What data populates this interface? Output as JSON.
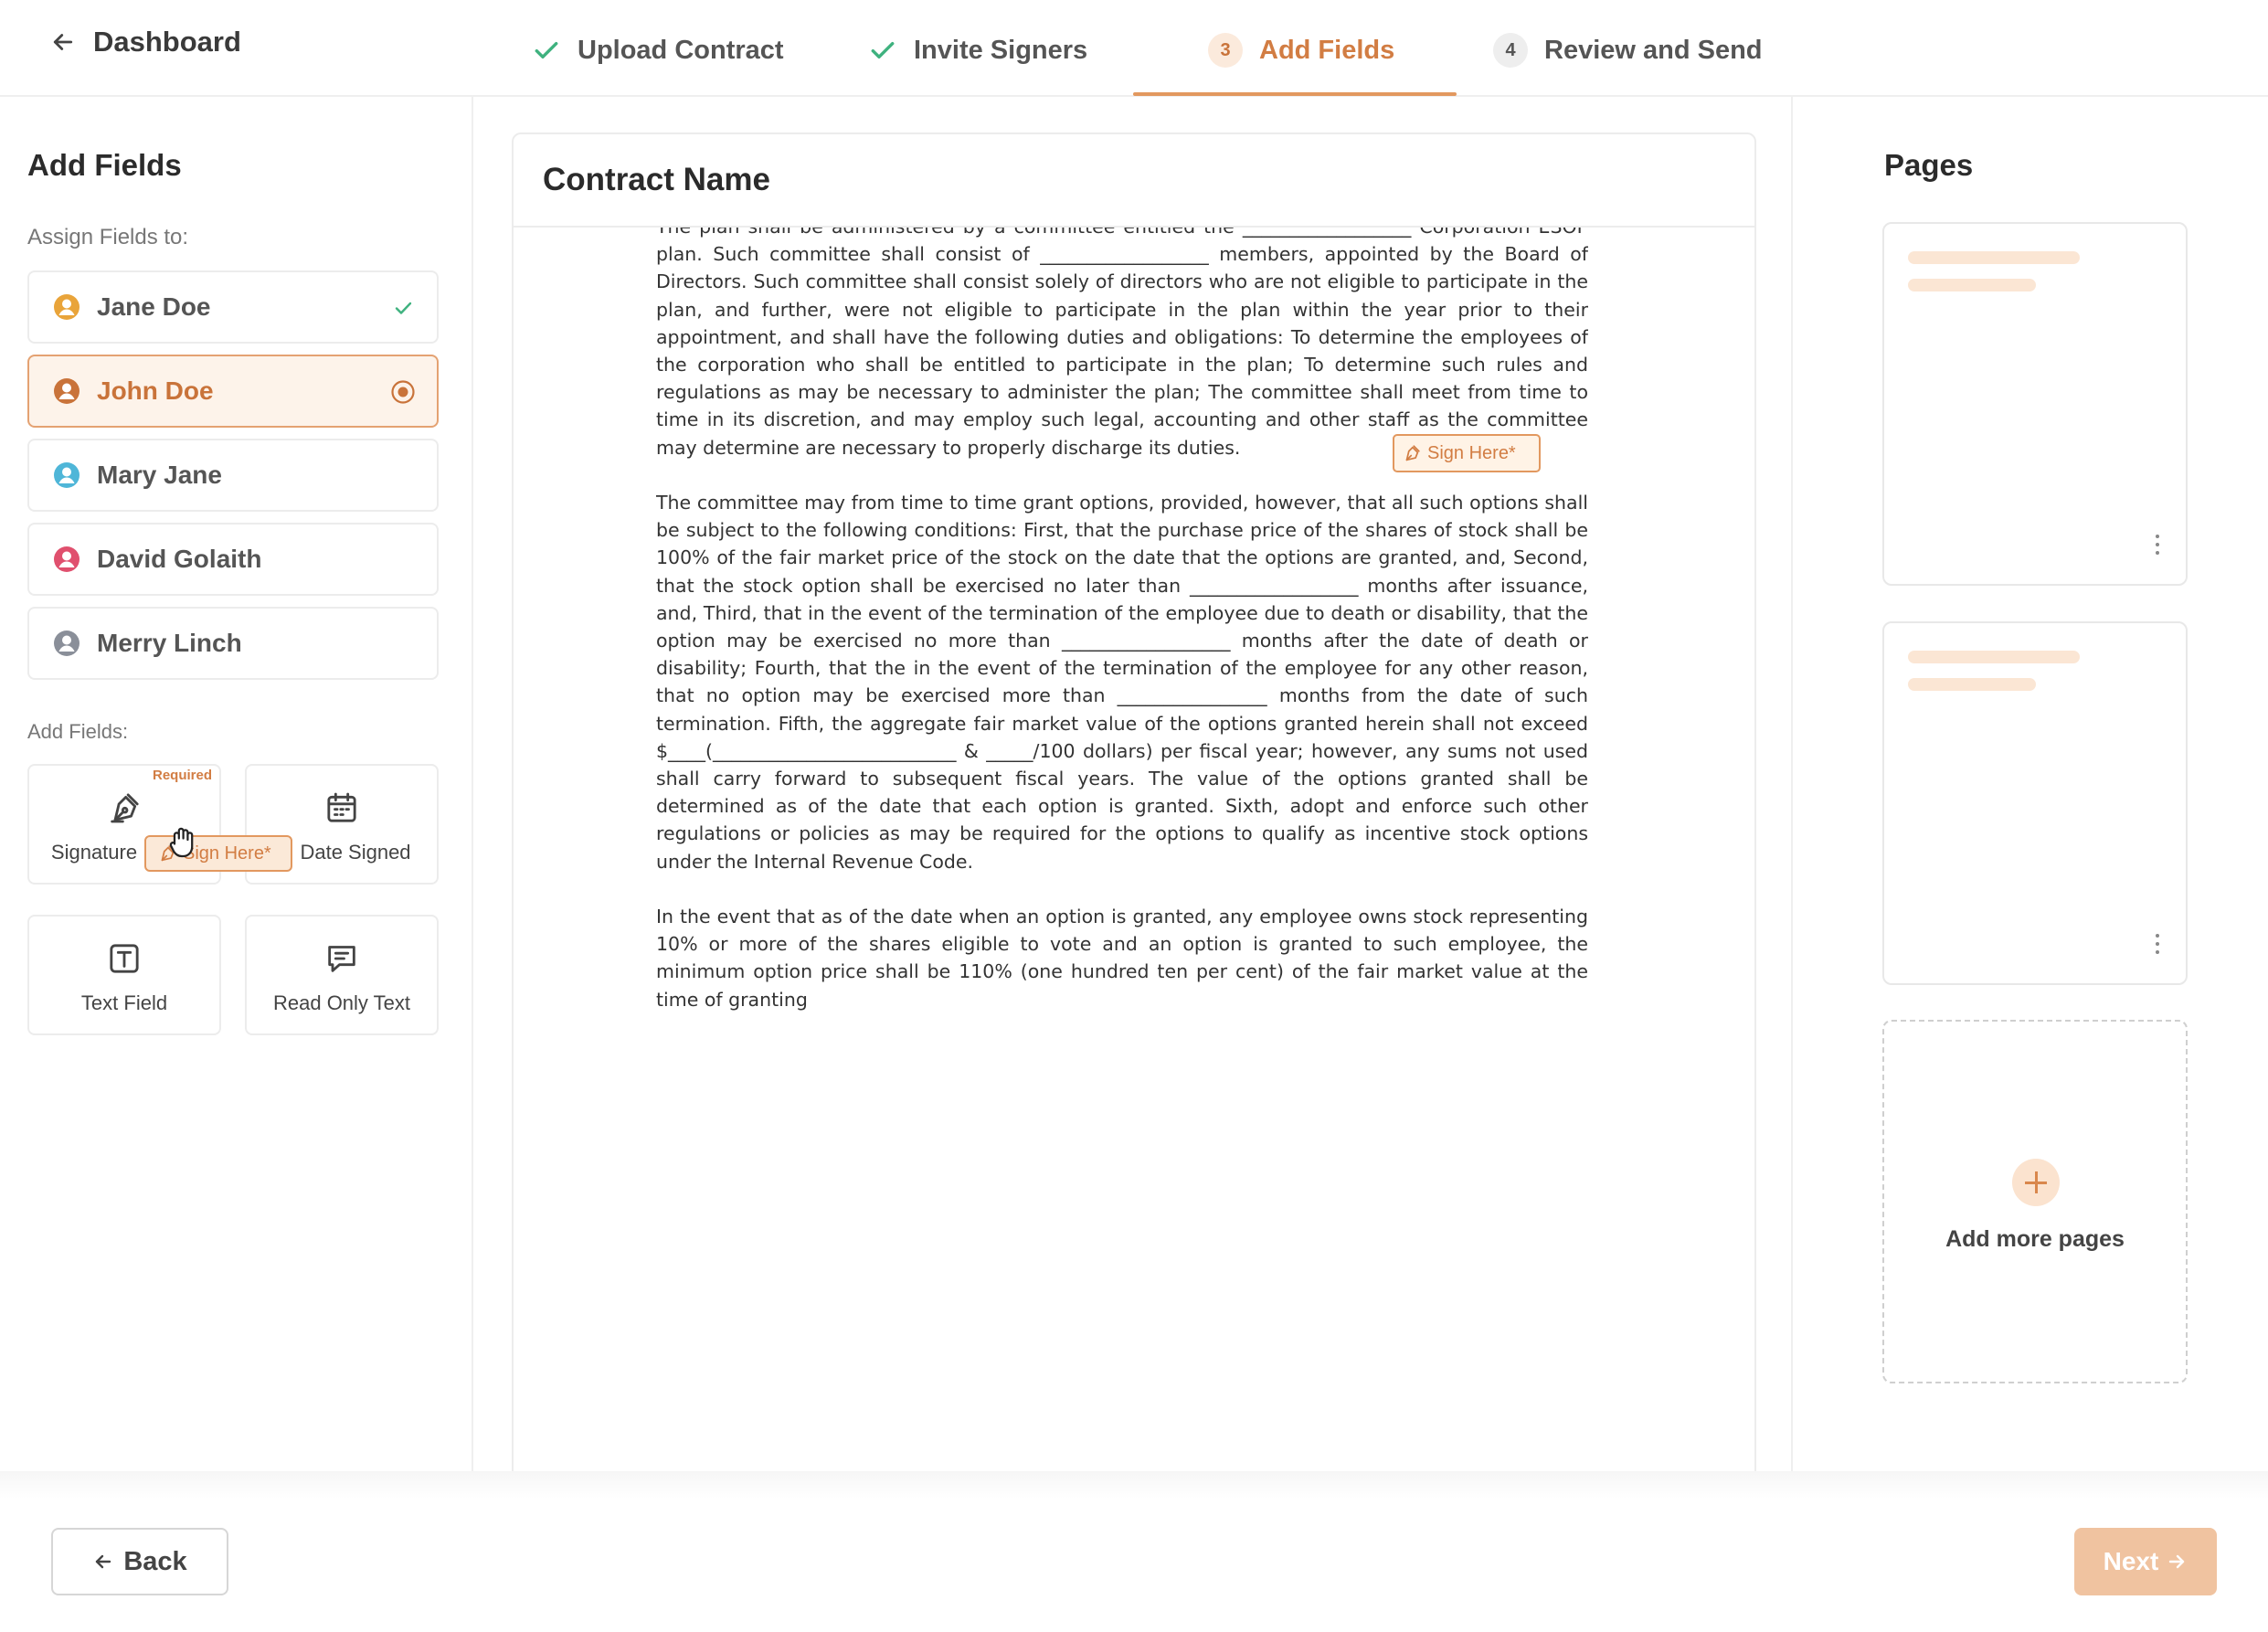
{
  "header": {
    "back_label": "Dashboard",
    "steps": [
      {
        "number": "",
        "label": "Upload Contract",
        "state": "done"
      },
      {
        "number": "",
        "label": "Invite Signers",
        "state": "done"
      },
      {
        "number": "3",
        "label": "Add Fields",
        "state": "active"
      },
      {
        "number": "4",
        "label": "Review and Send",
        "state": "future"
      }
    ]
  },
  "left_panel": {
    "title": "Add Fields",
    "assign_label": "Assign Fields to:",
    "signers": [
      {
        "name": "Jane Doe",
        "color": "#e9a43a",
        "status": "done"
      },
      {
        "name": "John Doe",
        "color": "#c9733a",
        "status": "selected"
      },
      {
        "name": "Mary Jane",
        "color": "#4fb6d8",
        "status": ""
      },
      {
        "name": "David Golaith",
        "color": "#e0506e",
        "status": ""
      },
      {
        "name": "Merry Linch",
        "color": "#8a8f99",
        "status": ""
      }
    ],
    "add_fields_label": "Add Fields:",
    "fields": [
      {
        "label": "Signature",
        "icon": "pen-nib-icon",
        "badge": "Required"
      },
      {
        "label": "Date Signed",
        "icon": "calendar-icon",
        "badge": ""
      },
      {
        "label": "Text Field",
        "icon": "text-box-icon",
        "badge": ""
      },
      {
        "label": "Read Only Text",
        "icon": "message-icon",
        "badge": ""
      }
    ],
    "drag_chip_label": "Sign Here*"
  },
  "document": {
    "title": "Contract Name",
    "paragraphs": [
      "The plan shall be administered by a committee entitled the __________________ Corporation ESOP plan. Such committee shall consist of __________________ members, appointed by the Board of Directors. Such committee shall consist solely of directors who are not eligible to participate in the plan, and further, were not eligible to participate in the plan within the year prior to their appointment, and shall have the following duties and obligations: To determine the employees of the corporation who shall be entitled to participate in the plan; To determine such rules and regulations as may be necessary to administer the plan; The committee shall meet from time to time in its discretion, and may employ such legal, accounting and other staff as the committee may determine are necessary to properly discharge its duties.",
      "The committee may from time to time grant options, provided, however, that all such options shall be subject to the following conditions: First, that the purchase price of the shares of stock shall be 100% of the fair market price of the stock on the date that the options are granted, and, Second, that the stock option shall be exercised no later than __________________ months after issuance, and, Third, that in the event of the termination of the employee due to death or disability, that the option may be exercised no more than __________________ months after the date of death or disability; Fourth, that the in the event of the termination of the employee for any other reason, that no option may be exercised more than ________________ months from the date of such termination. Fifth, the aggregate fair market value of the options granted herein shall not exceed $____(__________________________ & _____/100 dollars) per fiscal year; however, any sums not used shall carry forward to subsequent fiscal years. The value of the options granted shall be determined as of the date that each option is granted. Sixth, adopt and enforce such other regulations or policies as may be required for the options to qualify as incentive stock options under the Internal Revenue Code.",
      "In the event that as of the date when an option is granted, any employee owns stock representing 10% or more of the shares eligible to vote and an option is granted to such employee, the minimum option price shall be 110% (one hundred ten per cent) of the fair market value at the time of granting"
    ],
    "placed_field_label": "Sign Here*"
  },
  "right_panel": {
    "title": "Pages",
    "add_pages_label": "Add more pages"
  },
  "footer": {
    "back_label": "Back",
    "next_label": "Next"
  }
}
